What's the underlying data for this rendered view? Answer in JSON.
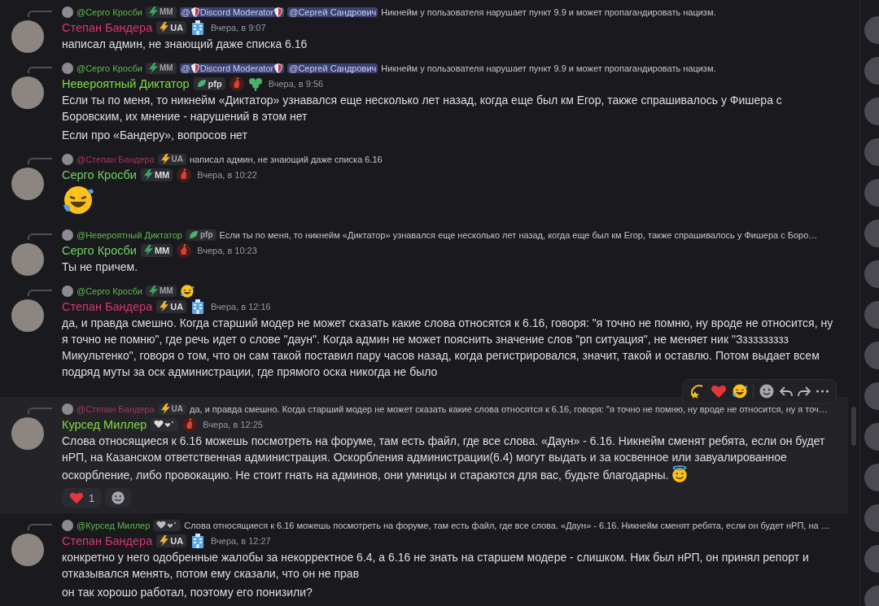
{
  "messages": [
    {
      "reply": {
        "author": "@Серго Кросби",
        "color": "#5fb84d",
        "tag": {
          "kind": "bolt",
          "label": "MM",
          "color": "#3ba55c"
        },
        "mentions": [
          {
            "kind": "role",
            "prefix": "@",
            "label": "Discord Moderator"
          },
          {
            "kind": "user",
            "prefix": "@",
            "label": "Сергей Сандрович"
          }
        ],
        "text": "Никнейм у пользователя нарушает пункт 9.9 и может пропагандировать нацизм."
      },
      "author": "Степан Бандера",
      "color": "#d9356f",
      "tag": {
        "kind": "bolt",
        "label": "UA",
        "color": "#f0b232"
      },
      "role_icons": [
        {
          "kind": "building"
        }
      ],
      "time": "Вчера, в 9:07",
      "paragraphs": [
        "написал админ, не знающий даже списка 6.16"
      ]
    },
    {
      "reply": {
        "author": "@Серго Кросби",
        "color": "#5fb84d",
        "tag": {
          "kind": "bolt",
          "label": "MM",
          "color": "#3ba55c"
        },
        "mentions": [
          {
            "kind": "role",
            "prefix": "@",
            "label": "Discord Moderator"
          },
          {
            "kind": "user",
            "prefix": "@",
            "label": "Сергей Сандрович"
          }
        ],
        "text": "Никнейм у пользователя нарушает пункт 9.9 и может пропагандировать нацизм."
      },
      "author": "Невероятный Диктатор",
      "color": "#7fdc45",
      "tag": {
        "kind": "leaf",
        "label": "pfp",
        "color": "#4caf6a"
      },
      "role_icons": [
        {
          "kind": "rooster"
        },
        {
          "kind": "clover"
        }
      ],
      "time": "Вчера, в 9:56",
      "paragraphs": [
        "Если ты по меня, то никнейм «Диктатор» узнавался еще несколько лет назад, когда еще был км Егор, также спрашивалось у Фишера с Боровским, их мнение - нарушений в этом нет",
        "Если про «Бандеру», вопросов нет"
      ]
    },
    {
      "reply": {
        "author": "@Степан Бандера",
        "color": "#a8365e",
        "tag": {
          "kind": "bolt",
          "label": "UA",
          "color": "#f0b232"
        },
        "text": "написал админ, не знающий даже списка 6.16"
      },
      "author": "Серго Кросби",
      "color": "#6fd35f",
      "tag": {
        "kind": "bolt",
        "label": "MM",
        "color": "#3ba55c"
      },
      "role_icons": [
        {
          "kind": "rooster"
        }
      ],
      "time": "Вчера, в 10:22",
      "big_emoji": {
        "kind": "laugh"
      }
    },
    {
      "reply": {
        "author": "@Невероятный Диктатор",
        "color": "#5fb84d",
        "tag": {
          "kind": "leaf",
          "label": "pfp",
          "color": "#4caf6a"
        },
        "text": "Если ты по меня, то никнейм «Диктатор» узнавался еще несколько лет назад, когда еще был км Егор, также спрашивалось у Фишера с Боро…"
      },
      "author": "Серго Кросби",
      "color": "#6fd35f",
      "tag": {
        "kind": "bolt",
        "label": "MM",
        "color": "#3ba55c"
      },
      "role_icons": [
        {
          "kind": "rooster"
        }
      ],
      "time": "Вчера, в 10:23",
      "paragraphs": [
        "Ты не причем."
      ]
    },
    {
      "reply": {
        "author": "@Серго Кросби",
        "color": "#5fb84d",
        "tag": {
          "kind": "bolt",
          "label": "MM",
          "color": "#3ba55c"
        },
        "emoji": {
          "kind": "laugh"
        }
      },
      "author": "Степан Бандера",
      "color": "#d9356f",
      "tag": {
        "kind": "bolt",
        "label": "UA",
        "color": "#f0b232"
      },
      "role_icons": [
        {
          "kind": "building"
        }
      ],
      "time": "Вчера, в 12:16",
      "paragraphs": [
        "да, и правда смешно. Когда старший модер не может сказать какие слова относятся к 6.16, говоря: \"я точно не помню, ну вроде не относится, ну я точно не помню\", где речь идет о слове \"даун\". Когда админ не может пояснить значение слов \"рп ситуация\",  не меняет ник \"Зззззззззз Микультенко\", говоря о том, что он сам такой поставил пару часов назад, когда регистрировался, значит, такой и оставлю. Потом выдает всем подряд муты за оск администрации, где прямого оска никогда не было"
      ]
    },
    {
      "reply": {
        "author": "@Степан Бандера",
        "color": "#a8365e",
        "tag": {
          "kind": "bolt",
          "label": "UA",
          "color": "#f0b232"
        },
        "text": "да, и правда смешно. Когда старший модер не может сказать какие слова относятся к 6.16, говоря: \"я точно не помню, ну вроде не относится, ну я точ…"
      },
      "author": "Курсед Миллер",
      "color": "#7fdc45",
      "tag": {
        "kind": "hearts",
        "color": "#dddddd"
      },
      "role_icons": [
        {
          "kind": "rooster"
        }
      ],
      "time": "Вчера, в 12:25",
      "paragraphs": [
        "Слова относящиеся к 6.16 можешь посмотреть на форуме, там есть файл, где все слова. «Даун» - 6.16. Никнейм сменят ребята, если он будет нРП, на Казанском ответственная администрация. Оскорбления администрации(6.4) могут выдать и за косвенное или завуалированное оскорбление, либо провокацию. Не стоит гнать на админов, они умницы и стараются для вас, будьте благодарны."
      ],
      "trailing_emoji": {
        "kind": "halo"
      },
      "reactions": [
        {
          "emoji": {
            "kind": "heart"
          },
          "count": "1",
          "selected": false
        }
      ],
      "hovered": true
    },
    {
      "reply": {
        "author": "@Курсед Миллер",
        "color": "#5fb84d",
        "tag": {
          "kind": "hearts",
          "color": "#bbbbbb"
        },
        "text": "Слова относящиеся к 6.16 можешь посмотреть на форуме, там есть файл, где все слова. «Даун» - 6.16. Никнейм сменят ребята, если он будет нРП, на …"
      },
      "author": "Степан Бандера",
      "color": "#d9356f",
      "tag": {
        "kind": "bolt",
        "label": "UA",
        "color": "#f0b232"
      },
      "role_icons": [
        {
          "kind": "building"
        }
      ],
      "time": "Вчера, в 12:27",
      "paragraphs": [
        "конкретно у него одобренные жалобы за некорректное 6.4, а 6.16 не знать на старшем модере - слишком. Ник был нРП, он принял репорт и отказывался менять, потом ему сказали, что он не прав",
        "он так хорошо работал, поэтому его понизили?"
      ]
    }
  ]
}
